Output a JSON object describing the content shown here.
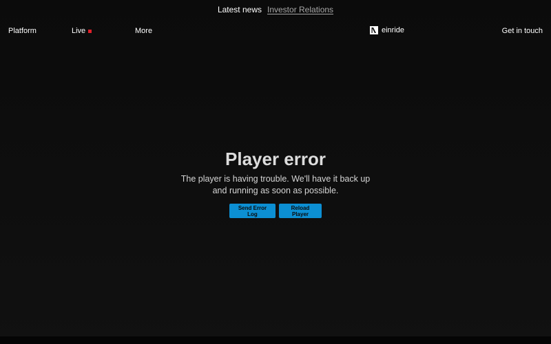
{
  "announcement": {
    "label": "Latest news",
    "link": "Investor Relations"
  },
  "nav": {
    "platform": "Platform",
    "live": "Live",
    "live_indicator_color": "#e0202a",
    "more": "More",
    "brand": "einride",
    "contact": "Get in touch"
  },
  "player_error": {
    "title": "Player error",
    "message": "The player is having trouble. We'll have it back up and running as soon as possible.",
    "send_log_label": "Send Error Log",
    "reload_label": "Reload Player",
    "button_color": "#0c8fd3"
  }
}
